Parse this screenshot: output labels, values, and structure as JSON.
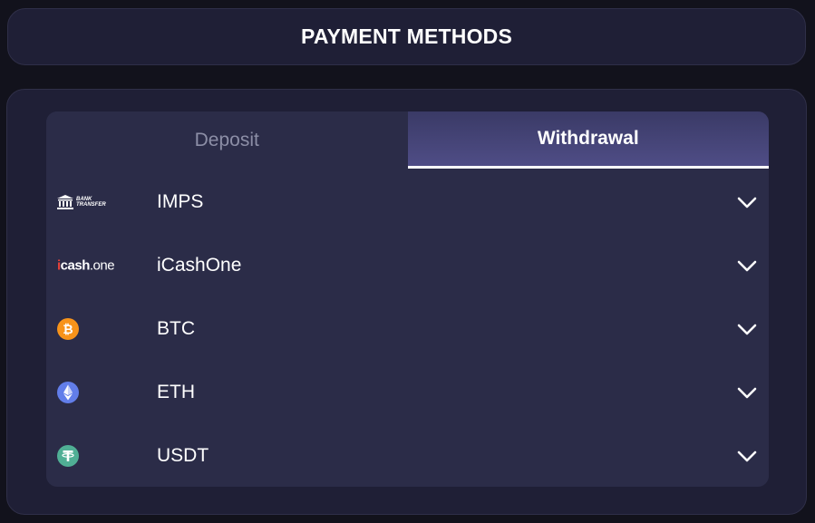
{
  "header": {
    "title": "PAYMENT METHODS"
  },
  "tabs": [
    {
      "label": "Deposit",
      "active": false
    },
    {
      "label": "Withdrawal",
      "active": true
    }
  ],
  "methods": [
    {
      "name": "IMPS",
      "logo": "bank-transfer-logo",
      "logo_text": [
        "BANK",
        "TRANSFER"
      ]
    },
    {
      "name": "iCashOne",
      "logo": "icashone-logo",
      "logo_text": [
        "i",
        "cash",
        ".one"
      ]
    },
    {
      "name": "BTC",
      "logo": "bitcoin-icon",
      "color": "#f7931a"
    },
    {
      "name": "ETH",
      "logo": "ethereum-icon",
      "color": "#627eea"
    },
    {
      "name": "USDT",
      "logo": "tether-icon",
      "color": "#50af95"
    }
  ],
  "colors": {
    "background": "#12121c",
    "card": "#1f1f36",
    "panel": "#2b2c48",
    "active_tab": "#4f4d86"
  }
}
